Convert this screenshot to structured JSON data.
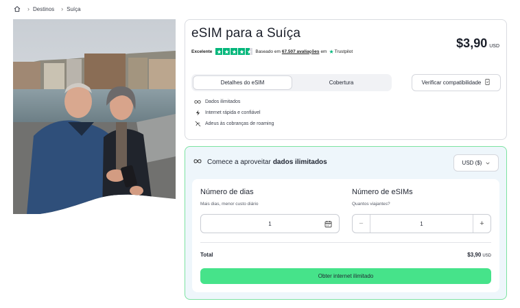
{
  "breadcrumb": {
    "home_icon": "home-icon",
    "items": [
      "Destinos",
      "Suíça"
    ]
  },
  "product": {
    "title": "eSIM para a Suíça",
    "rating": {
      "label": "Excelente",
      "stars": 4.5,
      "based_on": "Baseado em",
      "reviews": "67.507 avaliações",
      "on": "em",
      "provider": "Trustpilot"
    },
    "price": {
      "amount": "$3,90",
      "currency": "USD"
    },
    "tabs": [
      "Detalhes do eSIM",
      "Cobertura"
    ],
    "active_tab": 0,
    "verify_button": "Verificar compatibilidade",
    "features": [
      {
        "icon": "infinity-icon",
        "text": "Dados ilimitados"
      },
      {
        "icon": "lightning-icon",
        "text": "Internet rápida e confiável"
      },
      {
        "icon": "no-roaming-icon",
        "text": "Adeus às cobranças de roaming"
      }
    ]
  },
  "config": {
    "header_prefix": "Comece a aproveitar",
    "header_bold": "dados ilimitados",
    "currency_selector": "USD ($)",
    "days": {
      "label": "Número de dias",
      "hint": "Mais dias, menor custo diário",
      "value": "1"
    },
    "sims": {
      "label": "Número de eSIMs",
      "hint": "Quantos viajantes?",
      "value": "1",
      "minus": "−",
      "plus": "+"
    },
    "total_label": "Total",
    "total_amount": "$3,90",
    "total_currency": "USD",
    "cta": "Obter internet ilimitado"
  },
  "colors": {
    "accent_green": "#46e38a",
    "trustpilot_green": "#00b67a",
    "config_border": "#7be3a0",
    "config_bg": "#eef6fb"
  }
}
